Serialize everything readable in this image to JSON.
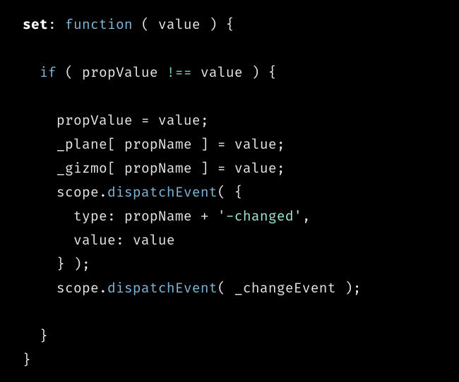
{
  "code": {
    "tokens": [
      {
        "t": "set",
        "c": "tok-kw"
      },
      {
        "t": ": ",
        "c": "tok-punct"
      },
      {
        "t": "function",
        "c": "tok-fn"
      },
      {
        "t": " ( ",
        "c": "tok-punct"
      },
      {
        "t": "value",
        "c": "tok-ident"
      },
      {
        "t": " ) {",
        "c": "tok-punct"
      },
      {
        "t": "\n",
        "c": ""
      },
      {
        "t": "\n",
        "c": ""
      },
      {
        "t": "  ",
        "c": ""
      },
      {
        "t": "if",
        "c": "tok-fn"
      },
      {
        "t": " ( ",
        "c": "tok-punct"
      },
      {
        "t": "propValue",
        "c": "tok-ident"
      },
      {
        "t": " ",
        "c": ""
      },
      {
        "t": "!==",
        "c": "tok-op"
      },
      {
        "t": " ",
        "c": ""
      },
      {
        "t": "value",
        "c": "tok-ident"
      },
      {
        "t": " ) {",
        "c": "tok-punct"
      },
      {
        "t": "\n",
        "c": ""
      },
      {
        "t": "\n",
        "c": ""
      },
      {
        "t": "    ",
        "c": ""
      },
      {
        "t": "propValue",
        "c": "tok-ident"
      },
      {
        "t": " ",
        "c": ""
      },
      {
        "t": "=",
        "c": "tok-op2"
      },
      {
        "t": " ",
        "c": ""
      },
      {
        "t": "value",
        "c": "tok-ident"
      },
      {
        "t": ";",
        "c": "tok-punct"
      },
      {
        "t": "\n",
        "c": ""
      },
      {
        "t": "    ",
        "c": ""
      },
      {
        "t": "_plane",
        "c": "tok-ident"
      },
      {
        "t": "[ ",
        "c": "tok-punct"
      },
      {
        "t": "propName",
        "c": "tok-ident"
      },
      {
        "t": " ] ",
        "c": "tok-punct"
      },
      {
        "t": "=",
        "c": "tok-op2"
      },
      {
        "t": " ",
        "c": ""
      },
      {
        "t": "value",
        "c": "tok-ident"
      },
      {
        "t": ";",
        "c": "tok-punct"
      },
      {
        "t": "\n",
        "c": ""
      },
      {
        "t": "    ",
        "c": ""
      },
      {
        "t": "_gizmo",
        "c": "tok-ident"
      },
      {
        "t": "[ ",
        "c": "tok-punct"
      },
      {
        "t": "propName",
        "c": "tok-ident"
      },
      {
        "t": " ] ",
        "c": "tok-punct"
      },
      {
        "t": "=",
        "c": "tok-op2"
      },
      {
        "t": " ",
        "c": ""
      },
      {
        "t": "value",
        "c": "tok-ident"
      },
      {
        "t": ";",
        "c": "tok-punct"
      },
      {
        "t": "\n",
        "c": ""
      },
      {
        "t": "    ",
        "c": ""
      },
      {
        "t": "scope",
        "c": "tok-ident"
      },
      {
        "t": ".",
        "c": "tok-punct"
      },
      {
        "t": "dispatchEvent",
        "c": "tok-fn"
      },
      {
        "t": "( {",
        "c": "tok-punct"
      },
      {
        "t": "\n",
        "c": ""
      },
      {
        "t": "      ",
        "c": ""
      },
      {
        "t": "type",
        "c": "tok-ident"
      },
      {
        "t": ": ",
        "c": "tok-punct"
      },
      {
        "t": "propName",
        "c": "tok-ident"
      },
      {
        "t": " ",
        "c": ""
      },
      {
        "t": "+",
        "c": "tok-op2"
      },
      {
        "t": " ",
        "c": ""
      },
      {
        "t": "'-changed'",
        "c": "tok-str"
      },
      {
        "t": ",",
        "c": "tok-punct"
      },
      {
        "t": "\n",
        "c": ""
      },
      {
        "t": "      ",
        "c": ""
      },
      {
        "t": "value",
        "c": "tok-ident"
      },
      {
        "t": ": ",
        "c": "tok-punct"
      },
      {
        "t": "value",
        "c": "tok-ident"
      },
      {
        "t": "\n",
        "c": ""
      },
      {
        "t": "    ",
        "c": ""
      },
      {
        "t": "} );",
        "c": "tok-punct"
      },
      {
        "t": "\n",
        "c": ""
      },
      {
        "t": "    ",
        "c": ""
      },
      {
        "t": "scope",
        "c": "tok-ident"
      },
      {
        "t": ".",
        "c": "tok-punct"
      },
      {
        "t": "dispatchEvent",
        "c": "tok-fn"
      },
      {
        "t": "( ",
        "c": "tok-punct"
      },
      {
        "t": "_changeEvent",
        "c": "tok-ident"
      },
      {
        "t": " );",
        "c": "tok-punct"
      },
      {
        "t": "\n",
        "c": ""
      },
      {
        "t": "\n",
        "c": ""
      },
      {
        "t": "  ",
        "c": ""
      },
      {
        "t": "}",
        "c": "tok-punct"
      },
      {
        "t": "\n",
        "c": ""
      },
      {
        "t": "}",
        "c": "tok-punct"
      }
    ]
  }
}
